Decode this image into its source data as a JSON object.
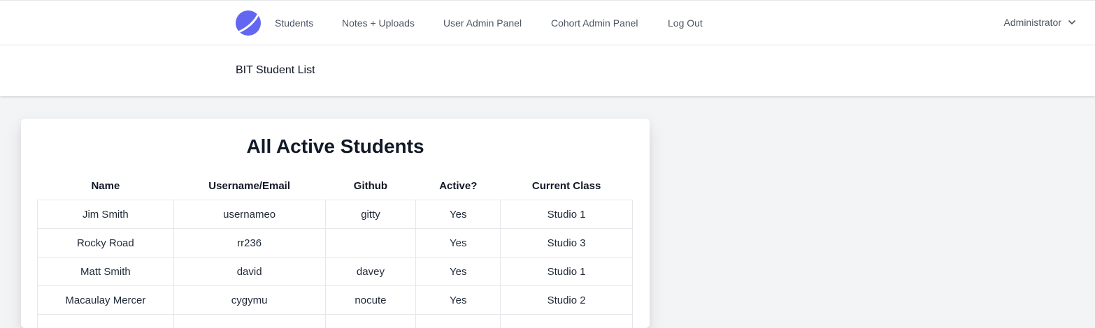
{
  "nav": {
    "logo": "planet-logo-icon",
    "links": [
      "Students",
      "Notes + Uploads",
      "User Admin Panel",
      "Cohort Admin Panel",
      "Log Out"
    ],
    "user": "Administrator",
    "accent": "#6366f1"
  },
  "header": {
    "title": "BIT Student List"
  },
  "card": {
    "title": "All Active Students"
  },
  "table": {
    "columns": [
      "Name",
      "Username/Email",
      "Github",
      "Active?",
      "Current Class"
    ],
    "rows": [
      [
        "Jim Smith",
        "usernameo",
        "gitty",
        "Yes",
        "Studio 1"
      ],
      [
        "Rocky Road",
        "rr236",
        "",
        "Yes",
        "Studio 3"
      ],
      [
        "Matt Smith",
        "david",
        "davey",
        "Yes",
        "Studio 1"
      ],
      [
        "Macaulay Mercer",
        "cygymu",
        "nocute",
        "Yes",
        "Studio 2"
      ],
      [
        "",
        "",
        "",
        "",
        ""
      ]
    ]
  }
}
